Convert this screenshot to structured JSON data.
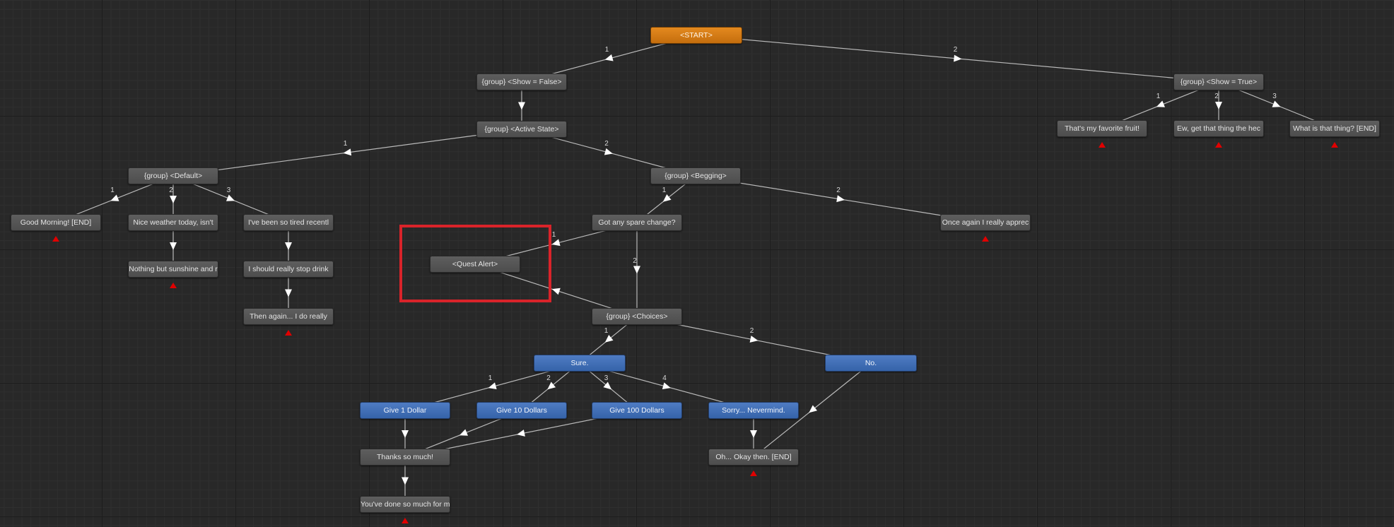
{
  "canvas": {
    "name": "dialogue-graph-editor"
  },
  "highlight": {
    "color": "#d9232a",
    "target": "n_quest"
  },
  "end_marker_color": "#e00000",
  "nodes": [
    {
      "id": "n_start",
      "label": "<START>",
      "style": "orange",
      "end": false
    },
    {
      "id": "n_showfalse",
      "label": "{group} <Show = False>",
      "style": "gray",
      "end": false
    },
    {
      "id": "n_active",
      "label": "{group} <Active State>",
      "style": "gray",
      "end": false
    },
    {
      "id": "n_showtrue",
      "label": "{group} <Show = True>",
      "style": "gray",
      "end": false
    },
    {
      "id": "n_fruit",
      "label": "That's my favorite fruit!",
      "style": "gray",
      "end": true
    },
    {
      "id": "n_ew",
      "label": "Ew, get that thing the hec",
      "style": "gray",
      "end": true
    },
    {
      "id": "n_what",
      "label": "What is that thing? [END]",
      "style": "gray",
      "end": true
    },
    {
      "id": "n_default",
      "label": "{group} <Default>",
      "style": "gray",
      "end": false
    },
    {
      "id": "n_begging",
      "label": "{group} <Begging>",
      "style": "gray",
      "end": false
    },
    {
      "id": "n_goodmorning",
      "label": "Good Morning! [END]",
      "style": "gray",
      "end": true
    },
    {
      "id": "n_weather",
      "label": "Nice weather today, isn't",
      "style": "gray",
      "end": false
    },
    {
      "id": "n_tired",
      "label": "I've been so tired recentl",
      "style": "gray",
      "end": false
    },
    {
      "id": "n_sunshine",
      "label": "Nothing but sunshine and r",
      "style": "gray",
      "end": true
    },
    {
      "id": "n_stop",
      "label": "I should really stop drink",
      "style": "gray",
      "end": false
    },
    {
      "id": "n_thenagain",
      "label": "Then again... I do really",
      "style": "gray",
      "end": true
    },
    {
      "id": "n_spare",
      "label": "Got any spare change?",
      "style": "gray",
      "end": false
    },
    {
      "id": "n_once",
      "label": "Once again I really apprec",
      "style": "gray",
      "end": true
    },
    {
      "id": "n_quest",
      "label": "<Quest Alert>",
      "style": "gray",
      "end": false
    },
    {
      "id": "n_choices",
      "label": "{group} <Choices>",
      "style": "gray",
      "end": false
    },
    {
      "id": "n_sure",
      "label": "Sure.",
      "style": "blue",
      "end": false
    },
    {
      "id": "n_no",
      "label": "No.",
      "style": "blue",
      "end": false
    },
    {
      "id": "n_give1",
      "label": "Give 1 Dollar",
      "style": "blue",
      "end": false
    },
    {
      "id": "n_give10",
      "label": "Give 10 Dollars",
      "style": "blue",
      "end": false
    },
    {
      "id": "n_give100",
      "label": "Give 100 Dollars",
      "style": "blue",
      "end": false
    },
    {
      "id": "n_sorry",
      "label": "Sorry... Nevermind.",
      "style": "blue",
      "end": false
    },
    {
      "id": "n_thanks",
      "label": "Thanks so much!",
      "style": "gray",
      "end": false
    },
    {
      "id": "n_okay",
      "label": "Oh... Okay then. [END]",
      "style": "gray",
      "end": true
    },
    {
      "id": "n_done",
      "label": "You've done so much for me",
      "style": "gray",
      "end": true
    }
  ],
  "edges": [
    {
      "from": "n_start",
      "to": "n_showfalse",
      "label": "1"
    },
    {
      "from": "n_start",
      "to": "n_showtrue",
      "label": "2"
    },
    {
      "from": "n_showfalse",
      "to": "n_active",
      "label": ""
    },
    {
      "from": "n_showtrue",
      "to": "n_fruit",
      "label": "1"
    },
    {
      "from": "n_showtrue",
      "to": "n_ew",
      "label": "2"
    },
    {
      "from": "n_showtrue",
      "to": "n_what",
      "label": "3"
    },
    {
      "from": "n_active",
      "to": "n_default",
      "label": "1"
    },
    {
      "from": "n_active",
      "to": "n_begging",
      "label": "2"
    },
    {
      "from": "n_default",
      "to": "n_goodmorning",
      "label": "1"
    },
    {
      "from": "n_default",
      "to": "n_weather",
      "label": "2"
    },
    {
      "from": "n_default",
      "to": "n_tired",
      "label": "3"
    },
    {
      "from": "n_weather",
      "to": "n_sunshine",
      "label": ""
    },
    {
      "from": "n_tired",
      "to": "n_stop",
      "label": ""
    },
    {
      "from": "n_stop",
      "to": "n_thenagain",
      "label": ""
    },
    {
      "from": "n_begging",
      "to": "n_spare",
      "label": "1"
    },
    {
      "from": "n_begging",
      "to": "n_once",
      "label": "2"
    },
    {
      "from": "n_spare",
      "to": "n_quest",
      "label": "1"
    },
    {
      "from": "n_spare",
      "to": "n_choices",
      "label": "2"
    },
    {
      "from": "n_choices",
      "to": "n_quest",
      "label": ""
    },
    {
      "from": "n_choices",
      "to": "n_sure",
      "label": "1"
    },
    {
      "from": "n_choices",
      "to": "n_no",
      "label": "2"
    },
    {
      "from": "n_sure",
      "to": "n_give1",
      "label": "1"
    },
    {
      "from": "n_sure",
      "to": "n_give10",
      "label": "2"
    },
    {
      "from": "n_sure",
      "to": "n_give100",
      "label": "3"
    },
    {
      "from": "n_sure",
      "to": "n_sorry",
      "label": "4"
    },
    {
      "from": "n_give1",
      "to": "n_thanks",
      "label": ""
    },
    {
      "from": "n_give10",
      "to": "n_thanks",
      "label": ""
    },
    {
      "from": "n_give100",
      "to": "n_thanks",
      "label": ""
    },
    {
      "from": "n_no",
      "to": "n_okay",
      "label": ""
    },
    {
      "from": "n_sorry",
      "to": "n_okay",
      "label": ""
    },
    {
      "from": "n_thanks",
      "to": "n_done",
      "label": ""
    }
  ]
}
